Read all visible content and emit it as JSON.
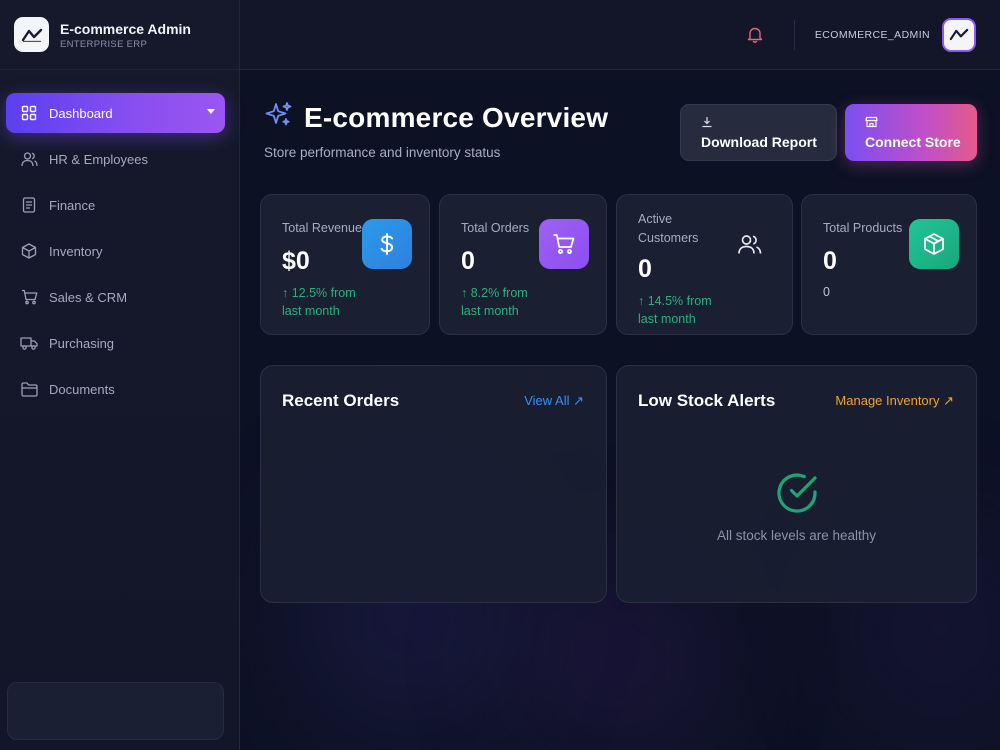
{
  "brand": {
    "title": "E-commerce Admin",
    "subtitle": "ENTERPRISE ERP"
  },
  "sidebar": {
    "items": [
      {
        "label": "Dashboard",
        "icon": "grid-icon",
        "active": true
      },
      {
        "label": "HR & Employees",
        "icon": "users-icon",
        "active": false
      },
      {
        "label": "Finance",
        "icon": "document-icon",
        "active": false
      },
      {
        "label": "Inventory",
        "icon": "box-icon",
        "active": false
      },
      {
        "label": "Sales & CRM",
        "icon": "cart-icon",
        "active": false
      },
      {
        "label": "Purchasing",
        "icon": "truck-icon",
        "active": false
      },
      {
        "label": "Documents",
        "icon": "folder-icon",
        "active": false
      }
    ]
  },
  "topbar": {
    "username": "ECOMMERCE_ADMIN"
  },
  "header": {
    "title": "E-commerce Overview",
    "subtitle": "Store performance and inventory status"
  },
  "actions": {
    "download": "Download Report",
    "connect": "Connect Store"
  },
  "stats": [
    {
      "label": "Total Revenue",
      "value": "$0",
      "trend_line1": "↑ 12.5% from",
      "trend_line2": "last month",
      "icon": "dollar-icon",
      "color": "#2f8fe6"
    },
    {
      "label": "Total Orders",
      "value": "0",
      "trend_line1": "↑ 8.2% from",
      "trend_line2": "last month",
      "icon": "cart-icon",
      "color": "#9a55f0"
    },
    {
      "label_line1": "Active",
      "label_line2": "Customers",
      "value": "0",
      "trend_line1": "↑ 14.5% from",
      "trend_line2": "last month",
      "icon": "users-icon"
    },
    {
      "label": "Total Products",
      "value": "0",
      "extra": "0",
      "icon": "box-icon",
      "color": "#1fb98a"
    }
  ],
  "panels": {
    "recent_orders": {
      "title": "Recent Orders",
      "link": "View All ↗",
      "link_color": "#3b8ef0"
    },
    "low_stock": {
      "title": "Low Stock Alerts",
      "link": "Manage Inventory ↗",
      "link_color": "#f0a32e",
      "empty_text": "All stock levels are healthy",
      "icon": "check-circle-icon",
      "icon_color": "#1fa574"
    }
  },
  "colors": {
    "accent": "#7b4ff2",
    "trend": "#27b27d"
  }
}
